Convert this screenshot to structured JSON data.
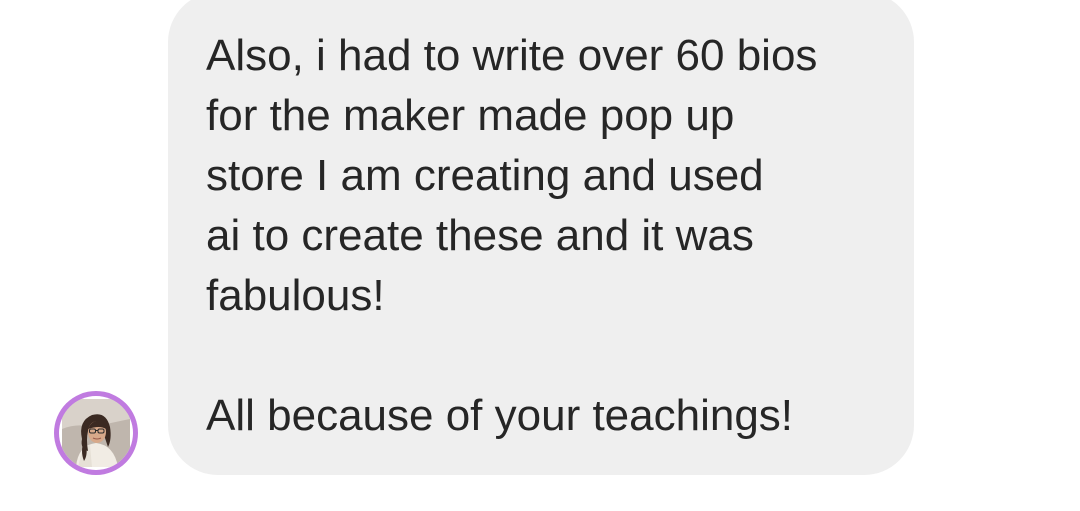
{
  "conversation": {
    "message": {
      "paragraph_1": "Also, i had to write over 60 bios\nfor the maker made pop up\nstore I am creating and used\nai to create these and it was\nfabulous!",
      "paragraph_2": "All because of your teachings!"
    },
    "avatar": {
      "icon": "profile-photo-icon",
      "ring_color": "#c07be0"
    },
    "bubble_color": "#efefef",
    "text_color": "#262626"
  }
}
